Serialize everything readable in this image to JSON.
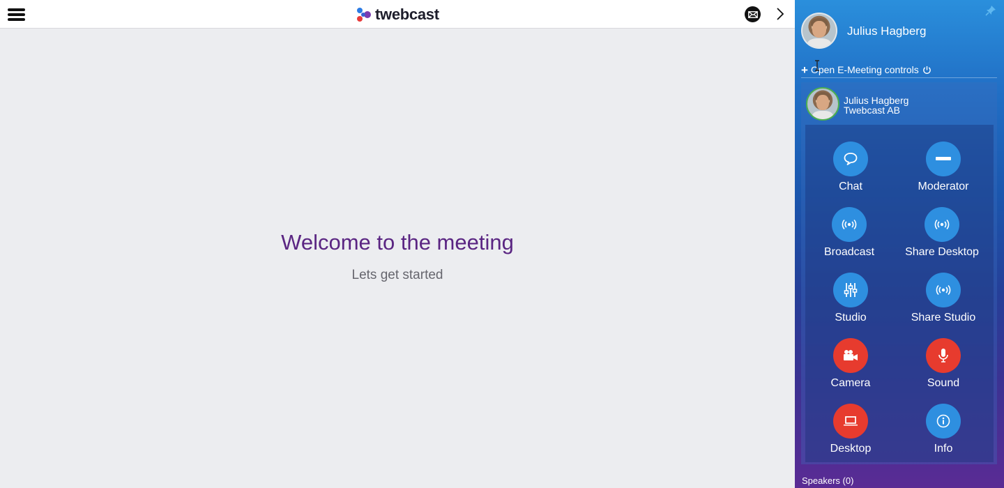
{
  "header": {
    "brand": "twebcast",
    "logo_colors": [
      "#2b7be4",
      "#e83a3a",
      "#7a3bb0"
    ]
  },
  "main": {
    "title": "Welcome to the meeting",
    "subtitle": "Lets get started"
  },
  "sidebar": {
    "user_name": "Julius Hagberg",
    "open_controls_label": "Open E-Meeting controls",
    "participant": {
      "name": "Julius Hagberg",
      "organization": "Twebcast AB"
    },
    "controls": [
      {
        "label": "Chat",
        "icon": "chat-bubble-icon",
        "color": "blue"
      },
      {
        "label": "Moderator",
        "icon": "minus-icon",
        "color": "blue"
      },
      {
        "label": "Broadcast",
        "icon": "broadcast-icon",
        "color": "blue"
      },
      {
        "label": "Share Desktop",
        "icon": "broadcast-icon",
        "color": "blue"
      },
      {
        "label": "Studio",
        "icon": "sliders-icon",
        "color": "blue"
      },
      {
        "label": "Share Studio",
        "icon": "broadcast-icon",
        "color": "blue"
      },
      {
        "label": "Camera",
        "icon": "camera-icon",
        "color": "red"
      },
      {
        "label": "Sound",
        "icon": "microphone-icon",
        "color": "red"
      },
      {
        "label": "Desktop",
        "icon": "laptop-icon",
        "color": "red"
      },
      {
        "label": "Info",
        "icon": "info-icon",
        "color": "blue"
      }
    ],
    "speakers_label": "Speakers (0)"
  },
  "colors": {
    "title_purple": "#5a2582",
    "control_blue": "#2e8fe0",
    "control_red": "#e73b2e"
  }
}
